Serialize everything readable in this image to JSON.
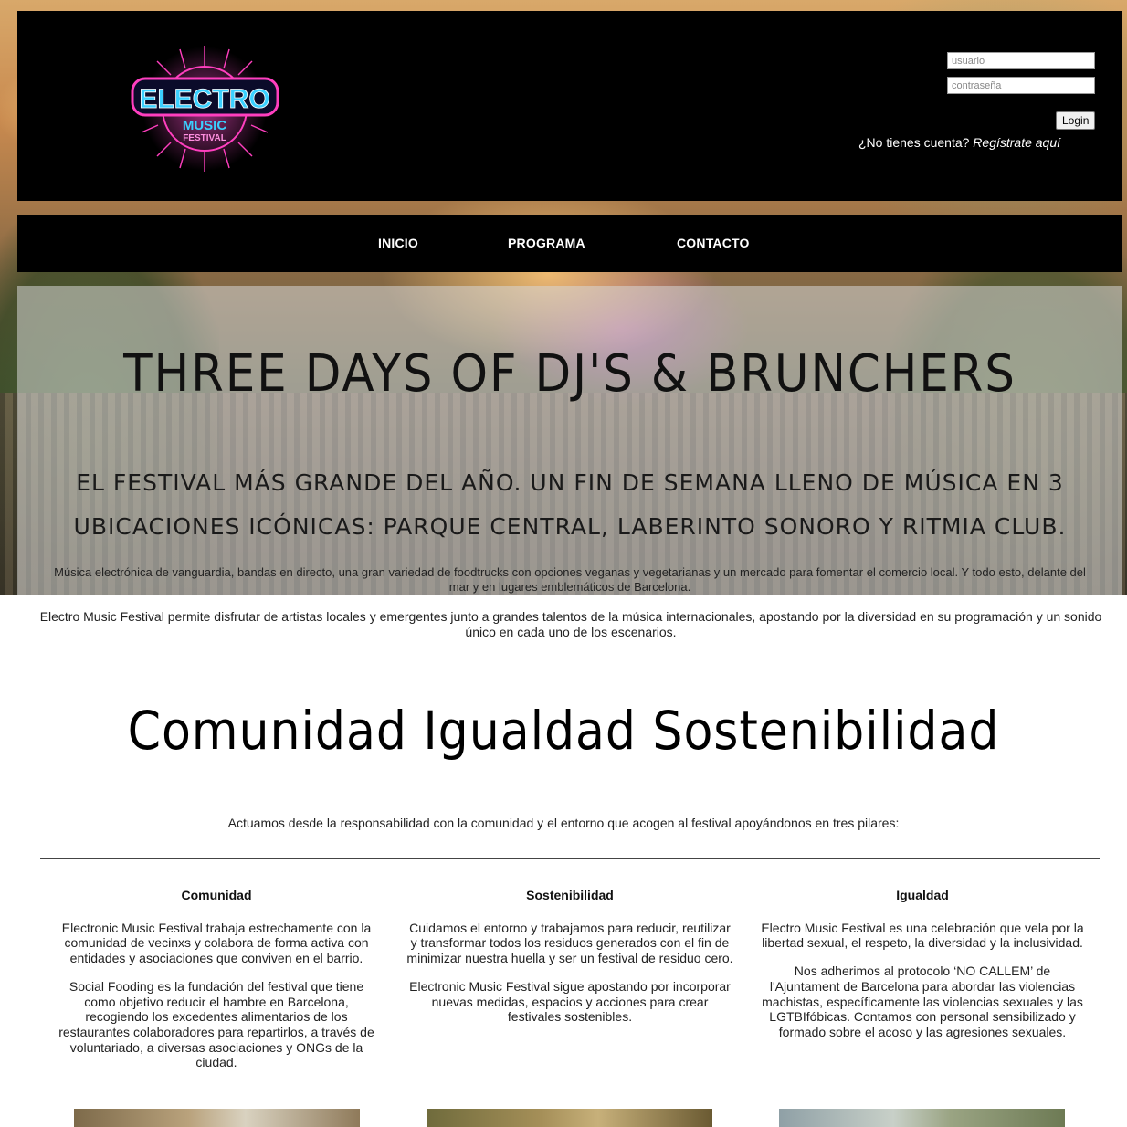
{
  "header": {
    "logo_main": "ELECTRO",
    "logo_sub1": "MUSIC",
    "logo_sub2": "FESTIVAL",
    "username_placeholder": "usuario",
    "password_placeholder": "contraseña",
    "login_label": "Login",
    "register_prompt": "¿No tienes cuenta?",
    "register_link": "Regístrate aquí"
  },
  "nav": {
    "items": [
      "INICIO",
      "PROGRAMA",
      "CONTACTO"
    ]
  },
  "hero": {
    "title": "THREE DAYS OF DJ'S & BRUNCHERS",
    "subtitle": "EL FESTIVAL MÁS GRANDE DEL AÑO. UN FIN DE SEMANA LLENO DE MÚSICA EN 3 UBICACIONES ICÓNICAS: PARQUE CENTRAL, LABERINTO SONORO Y RITMIA CLUB.",
    "description": "Música electrónica de vanguardia, bandas en directo, una gran variedad de foodtrucks con opciones veganas y vegetarianas y un mercado para fomentar el comercio local. Y todo esto, delante del mar y en lugares emblemáticos de Barcelona."
  },
  "intro": "Electro Music Festival permite disfrutar de artistas locales y emergentes junto a grandes talentos de la música internacionales, apostando por la diversidad en su programación y un sonido único en cada uno de los escenarios.",
  "pillars": {
    "title": "Comunidad Igualdad Sostenibilidad",
    "lead": "Actuamos desde la responsabilidad con la comunidad y el entorno que acogen al festival apoyándonos en tres pilares:",
    "columns": [
      {
        "heading": "Comunidad",
        "p1": "Electronic Music Festival trabaja estrechamente con la comunidad de vecinxs y colabora de forma activa con entidades y asociaciones que conviven en el barrio.",
        "p2": "Social Fooding es la fundación del festival que tiene como objetivo reducir el hambre en Barcelona, recogiendo los excedentes alimentarios de los restaurantes colaboradores para repartirlos, a través de voluntariado, a diversas asociaciones y ONGs de la ciudad."
      },
      {
        "heading": "Sostenibilidad",
        "p1": "Cuidamos el entorno y trabajamos para reducir, reutilizar y transformar todos los residuos generados con el fin de minimizar nuestra huella y ser un festival de residuo cero.",
        "p2": "Electronic Music Festival sigue apostando por incorporar nuevas medidas, espacios y acciones para crear festivales sostenibles."
      },
      {
        "heading": "Igualdad",
        "p1": "Electro Music Festival es una celebración que vela por la libertad sexual, el respeto, la diversidad y la inclusividad.",
        "p2": "Nos adherimos al protocolo ‘NO CALLEM’ de l'Ajuntament de Barcelona para abordar las violencias machistas, específicamente las violencias sexuales y las LGTBIfóbicas. Contamos con personal sensibilizado y formado sobre el acoso y las agresiones sexuales."
      }
    ]
  },
  "colors": {
    "header_bg": "#000000",
    "logo_cyan": "#3ad0ff",
    "logo_magenta": "#ff2fb3"
  }
}
